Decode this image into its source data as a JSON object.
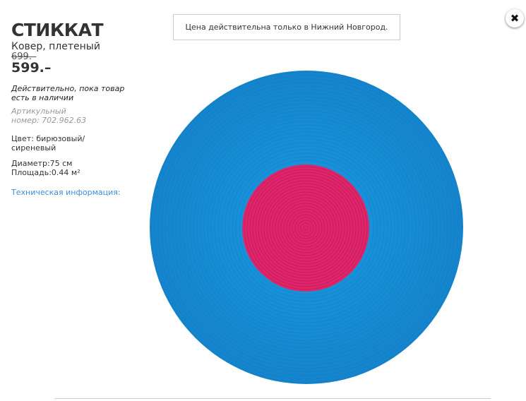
{
  "product": {
    "name": "СТИККАТ",
    "type": "Ковер, плетеный",
    "old_price": "699.–",
    "price": "599.–",
    "availability": "Действительно, пока товар есть в наличии",
    "article": "Артикульный номер: 702.962.63",
    "color": "Цвет: бирюзовый/ сиреневый",
    "diameter": "Диаметр:75 см",
    "area": "Площадь:0.44 м²",
    "tech_link": "Техническая информация:"
  },
  "notice": "Цена действительна только в Нижний Новгород.",
  "close_icon": "close-icon",
  "colors": {
    "outer": "#1a8fd6",
    "inner": "#e0266a",
    "link": "#3a8fd8"
  }
}
